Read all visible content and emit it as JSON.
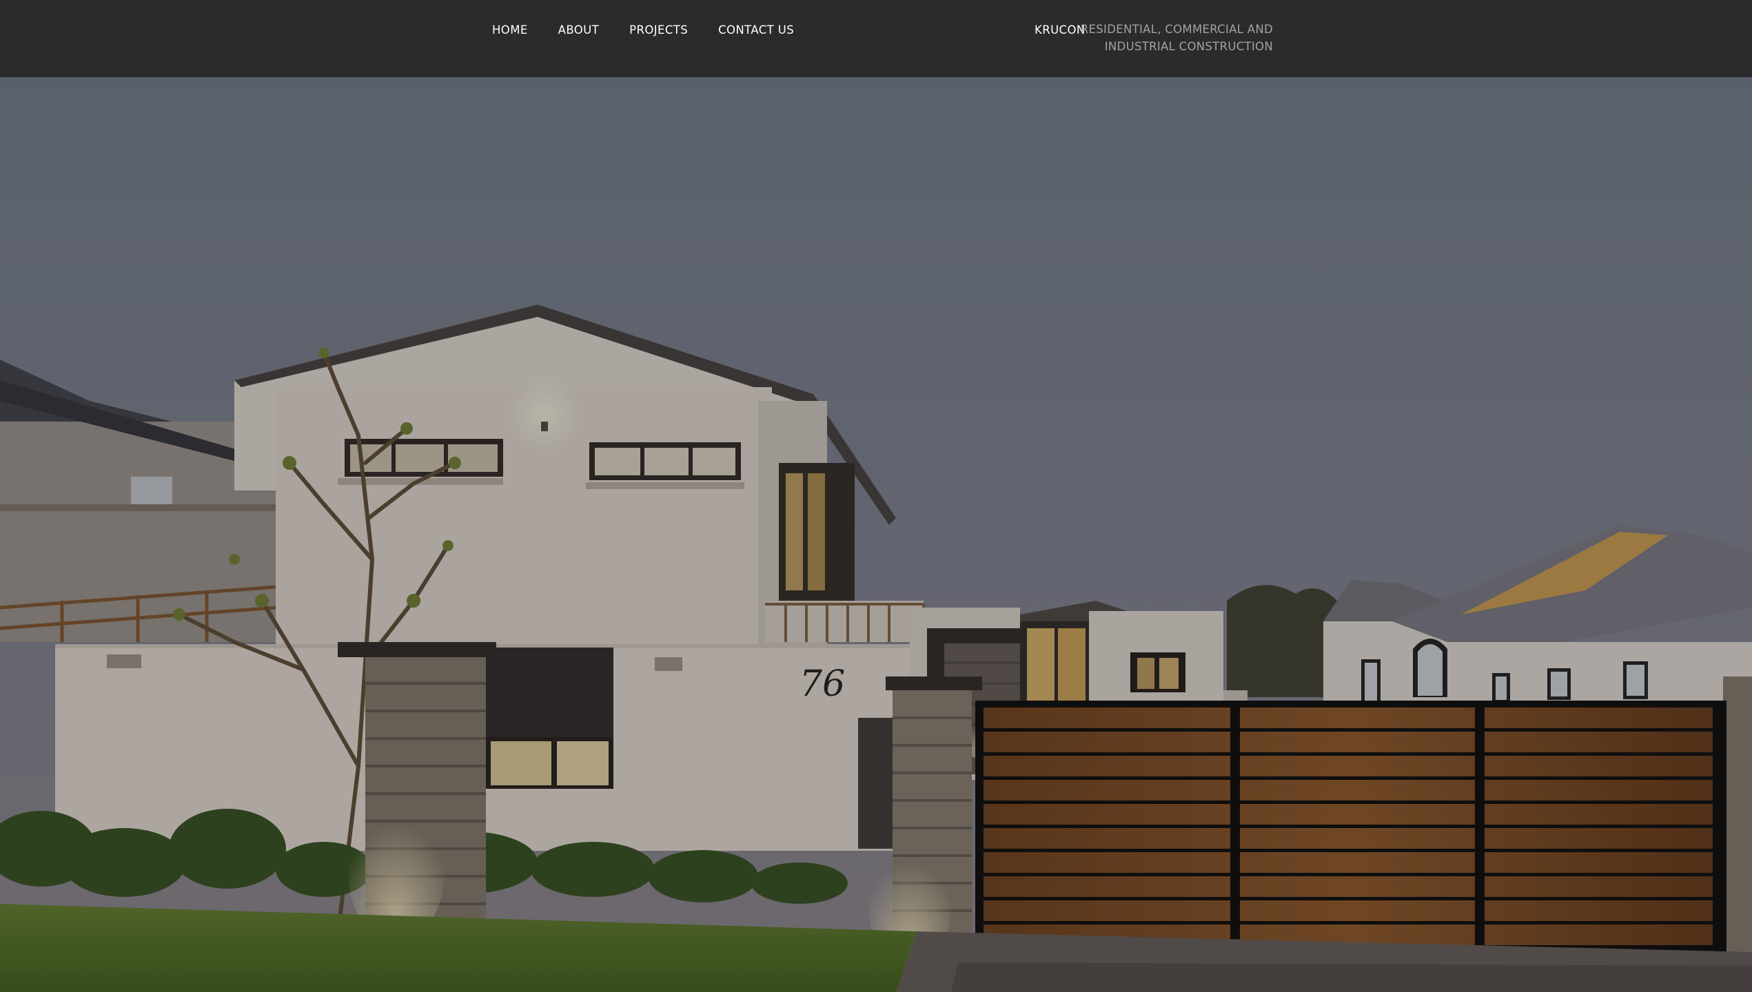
{
  "nav": {
    "items": [
      {
        "label": "HOME"
      },
      {
        "label": "ABOUT"
      },
      {
        "label": "PROJECTS"
      },
      {
        "label": "CONTACT US"
      }
    ]
  },
  "brand": {
    "name": "KRUCON",
    "tagline_line1": "RESIDENTIAL, COMMERCIAL AND",
    "tagline_line2": "INDUSTRIAL CONSTRUCTION"
  },
  "hero": {
    "house_number": "76"
  },
  "colors": {
    "header_bg": "#2b2b2d",
    "nav_text": "#ffffff",
    "tagline_text": "#a3a3a3"
  }
}
